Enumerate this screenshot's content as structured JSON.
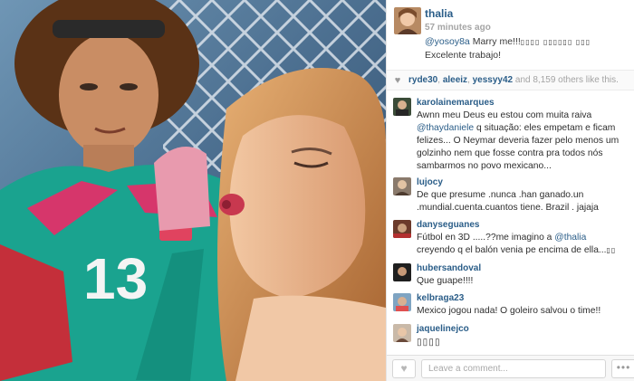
{
  "post": {
    "username": "thalia",
    "time": "57 minutes ago",
    "caption_mention": "@yosoy8a",
    "caption_text": " Marry me!!!",
    "caption_symbols": "▯▯▯▯ ▯▯▯▯▯▯ ▯▯▯",
    "caption_line2": "Excelente trabajo!"
  },
  "likes": {
    "users": [
      "ryde30",
      "aleeiz",
      "yessyy42"
    ],
    "sep1": ", ",
    "sep2": ", ",
    "and_text": " and ",
    "count": "8,159",
    "tail": " others like this."
  },
  "comments": [
    {
      "user": "karolainemarques",
      "text": "Awnn meu Deus eu estou com muita raiva "
    },
    {
      "user": "lujocy",
      "text": "De que presume .nunca .han ganado.un .mundial.cuenta.cuantos tiene. Brazil . jajaja"
    },
    {
      "user": "danyseguanes",
      "text": "Fútbol en 3D .....??me imagino a "
    },
    {
      "user": "hubersandoval",
      "text": "Que guape!!!!"
    },
    {
      "user": "kelbraga23",
      "text": "Mexico jogou nada! O goleiro salvou o time!!"
    },
    {
      "user": "jaquelinejco",
      "text": "▯▯▯▯"
    }
  ],
  "comment0": {
    "mention": "@thaydaniele",
    "rest": " q situação: eles empetam e ficam felizes... O Neymar deveria fazer pelo menos um golzinho nem que fosse contra pra todos nós sambarmos no povo mexicano..."
  },
  "comment2": {
    "mention": "@thalia",
    "rest": " creyendo q el balón venia pe encima de ella...",
    "symbols": "▯▯"
  },
  "photo": {
    "jersey_number": "13"
  },
  "footer": {
    "placeholder": "Leave a comment...",
    "more": "•••"
  },
  "icons": {
    "heart": "heart-icon",
    "more": "more-options-icon"
  },
  "colors": {
    "link": "#2a5d88",
    "muted": "#a5a5a5"
  }
}
